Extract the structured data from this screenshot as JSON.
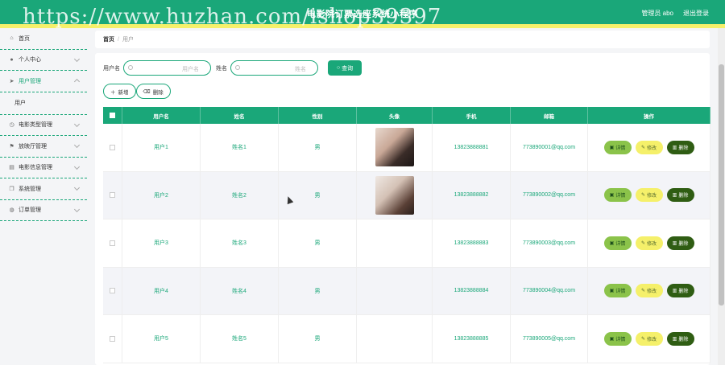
{
  "header": {
    "app_title": "电影院订票选座系统小程序",
    "user_label": "管理员 abo",
    "logout_label": "退出登录",
    "watermark": "https://www.huzhan.com/ishop39397"
  },
  "sidebar": {
    "items": [
      {
        "label": "首页",
        "icon": "home-icon",
        "glyph": "⌂"
      },
      {
        "label": "个人中心",
        "icon": "user-icon",
        "glyph": "●"
      },
      {
        "label": "用户管理",
        "icon": "send-icon",
        "glyph": "➤"
      },
      {
        "label": "用户",
        "icon": "",
        "glyph": ""
      },
      {
        "label": "电影类型管理",
        "icon": "clock-icon",
        "glyph": "◷"
      },
      {
        "label": "放映厅管理",
        "icon": "flag-icon",
        "glyph": "⚑"
      },
      {
        "label": "电影信息管理",
        "icon": "trash-icon",
        "glyph": "▤"
      },
      {
        "label": "系统管理",
        "icon": "copy-icon",
        "glyph": "❐"
      },
      {
        "label": "订单管理",
        "icon": "globe-icon",
        "glyph": "◍"
      }
    ]
  },
  "breadcrumb": {
    "home": "首页",
    "separator": "/",
    "current": "用户"
  },
  "search": {
    "username_label": "用户名",
    "username_placeholder": "用户名",
    "name_label": "姓名",
    "name_placeholder": "姓名",
    "search_button": "查询"
  },
  "actions": {
    "add": "新增",
    "delete": "删除"
  },
  "table": {
    "columns": [
      "用户名",
      "姓名",
      "性别",
      "头像",
      "手机",
      "邮箱",
      "操作"
    ],
    "rows": [
      {
        "username": "用户1",
        "name": "姓名1",
        "gender": "男",
        "avatar": "photo",
        "phone": "13823888881",
        "email": "773890001@qq.com"
      },
      {
        "username": "用户2",
        "name": "姓名2",
        "gender": "男",
        "avatar": "photo",
        "phone": "13823888882",
        "email": "773890002@qq.com"
      },
      {
        "username": "用户3",
        "name": "姓名3",
        "gender": "男",
        "avatar": "",
        "phone": "13823888883",
        "email": "773890003@qq.com"
      },
      {
        "username": "用户4",
        "name": "姓名4",
        "gender": "男",
        "avatar": "",
        "phone": "13823888884",
        "email": "773890004@qq.com"
      },
      {
        "username": "用户5",
        "name": "姓名5",
        "gender": "男",
        "avatar": "",
        "phone": "13823888885",
        "email": "773890005@qq.com"
      }
    ],
    "op_labels": {
      "detail": "详情",
      "edit": "修改",
      "delete": "删除"
    }
  },
  "colors": {
    "primary": "#1aa779",
    "accent_yellow": "#f5f06a",
    "detail": "#8bc34a",
    "delete": "#2f5d13"
  }
}
